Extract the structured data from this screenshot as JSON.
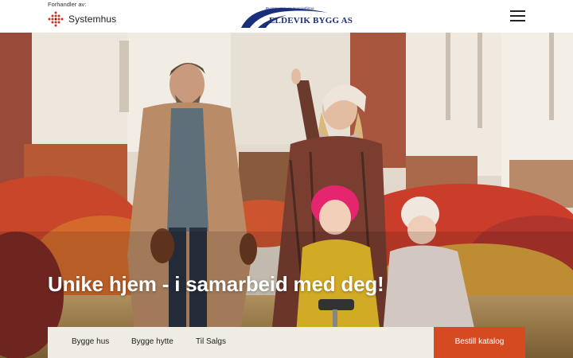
{
  "header": {
    "dealer_label": "Forhandler av:",
    "partner_name": "Systemhus",
    "brand_subtitle": "Byggmester- og ingeniørfirma",
    "brand_name": "ELDEVIK BYGG AS",
    "menu_icon": "hamburger-menu-icon"
  },
  "hero": {
    "title": "Unike hjem - i samarbeid med deg!"
  },
  "nav": {
    "links": [
      "Bygge hus",
      "Bygge hytte",
      "Til Salgs"
    ],
    "order_label": "Bestill katalog"
  },
  "colors": {
    "brand_blue": "#1a2f7a",
    "accent_red": "#d64a22",
    "nav_bg": "#efece4"
  }
}
